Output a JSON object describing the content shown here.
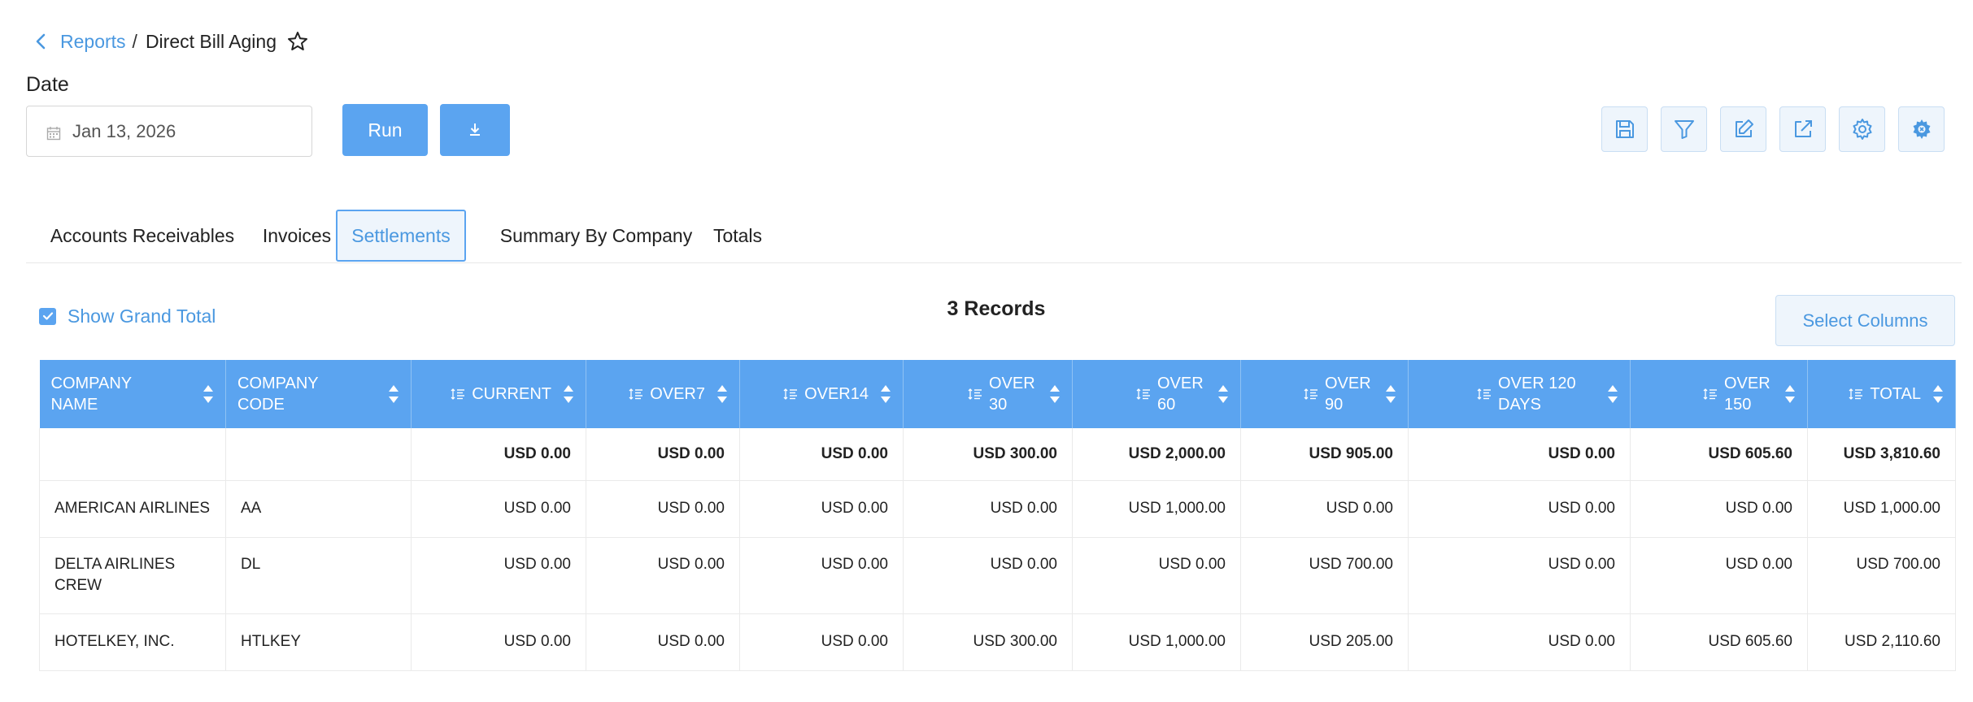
{
  "breadcrumb": {
    "parent": "Reports",
    "separator": "/",
    "current": "Direct Bill Aging"
  },
  "date_filter": {
    "label": "Date",
    "value": "Jan 13, 2026"
  },
  "actions": {
    "run_label": "Run"
  },
  "tabs": [
    {
      "label": "Accounts Receivables"
    },
    {
      "label": "Invoices"
    },
    {
      "label": "Settlements",
      "active": true
    },
    {
      "label": "Summary By Company"
    },
    {
      "label": "Totals"
    }
  ],
  "summary": {
    "grand_total_label": "Show Grand Total",
    "records": "3 Records",
    "select_columns_label": "Select Columns"
  },
  "table": {
    "columns": [
      {
        "label": "COMPANY NAME"
      },
      {
        "label": "COMPANY CODE"
      },
      {
        "label": "CURRENT"
      },
      {
        "label": "OVER7"
      },
      {
        "label": "OVER14"
      },
      {
        "label": "OVER 30"
      },
      {
        "label": "OVER 60"
      },
      {
        "label": "OVER 90"
      },
      {
        "label": "OVER 120 DAYS"
      },
      {
        "label": "OVER 150"
      },
      {
        "label": "TOTAL"
      }
    ],
    "totals": [
      "",
      "",
      "USD 0.00",
      "USD 0.00",
      "USD 0.00",
      "USD 300.00",
      "USD 2,000.00",
      "USD 905.00",
      "USD 0.00",
      "USD 605.60",
      "USD 3,810.60"
    ],
    "rows": [
      [
        "AMERICAN AIRLINES",
        "AA",
        "USD 0.00",
        "USD 0.00",
        "USD 0.00",
        "USD 0.00",
        "USD 1,000.00",
        "USD 0.00",
        "USD 0.00",
        "USD 0.00",
        "USD 1,000.00"
      ],
      [
        "DELTA AIRLINES CREW",
        "DL",
        "USD 0.00",
        "USD 0.00",
        "USD 0.00",
        "USD 0.00",
        "USD 0.00",
        "USD 700.00",
        "USD 0.00",
        "USD 0.00",
        "USD 700.00"
      ],
      [
        "HOTELKEY, INC.",
        "HTLKEY",
        "USD 0.00",
        "USD 0.00",
        "USD 0.00",
        "USD 300.00",
        "USD 1,000.00",
        "USD 205.00",
        "USD 0.00",
        "USD 605.60",
        "USD 2,110.60"
      ]
    ]
  },
  "icons": {
    "back": "chevron-left-icon",
    "favorite": "star-icon",
    "calendar": "calendar-icon",
    "download": "download-icon",
    "toolbar": [
      "save-icon",
      "filter-icon",
      "edit-icon",
      "external-link-icon",
      "settings-icon",
      "advanced-settings-icon"
    ],
    "sort": "sort-icon",
    "column": "column-values-icon"
  },
  "colors": {
    "accent": "#5ba4f0",
    "link": "#4a98e0",
    "accent_light": "#eef5fc"
  }
}
